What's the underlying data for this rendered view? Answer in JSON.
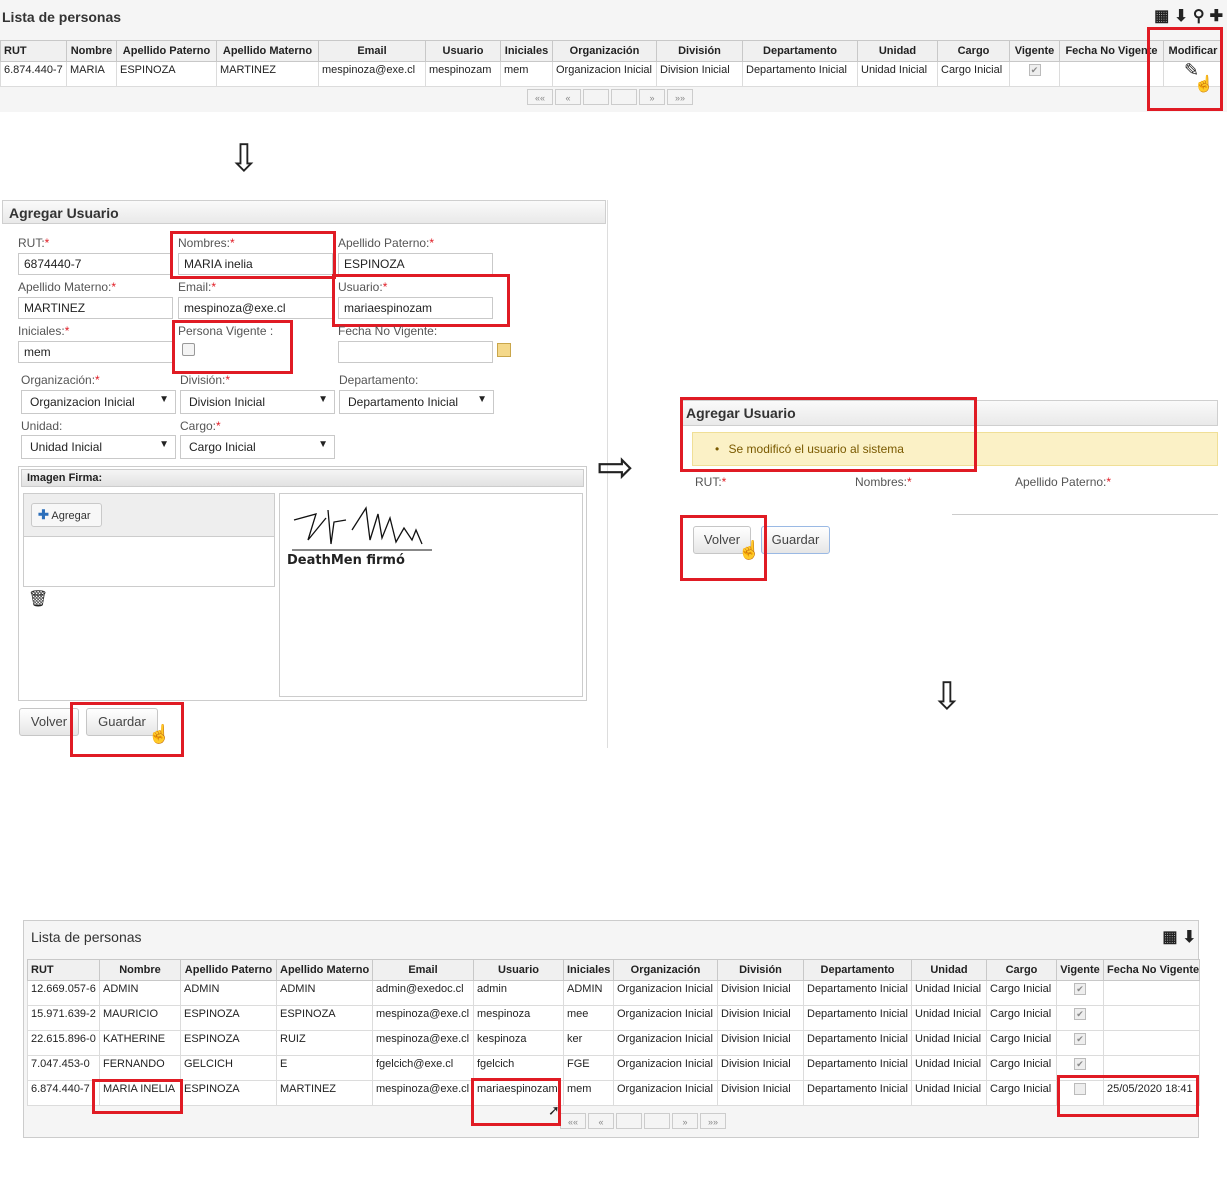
{
  "top_list": {
    "title": "Lista de personas",
    "columns": [
      "RUT",
      "Nombre",
      "Apellido Paterno",
      "Apellido Materno",
      "Email",
      "Usuario",
      "Iniciales",
      "Organización",
      "División",
      "Departamento",
      "Unidad",
      "Cargo",
      "Vigente",
      "Fecha No Vigente",
      "Modificar"
    ],
    "row": [
      "6.874.440-7",
      "MARIA",
      "ESPINOZA",
      "MARTINEZ",
      "mespinoza@exe.cl",
      "mespinozam",
      "mem",
      "Organizacion Inicial",
      "Division Inicial",
      "Departamento Inicial",
      "Unidad Inicial",
      "Cargo Inicial"
    ],
    "vigente_mark": "✔",
    "pager": [
      "««",
      "«",
      "",
      "",
      "»",
      "»»"
    ]
  },
  "form": {
    "title": "Agregar Usuario",
    "required_mark": "*",
    "rut_label": "RUT:",
    "rut_value": "6874440-7",
    "nombres_label": "Nombres:",
    "nombres_value": "MARIA inelia",
    "ap_pat_label": "Apellido Paterno:",
    "ap_pat_value": "ESPINOZA",
    "ap_mat_label": "Apellido Materno:",
    "ap_mat_value": "MARTINEZ",
    "email_label": "Email:",
    "email_value": "mespinoza@exe.cl",
    "usuario_label": "Usuario:",
    "usuario_value": "mariaespinozam",
    "iniciales_label": "Iniciales:",
    "iniciales_value": "mem",
    "vigente_label": "Persona Vigente :",
    "fecha_label": "Fecha No Vigente:",
    "org_label": "Organización:",
    "org_value": "Organizacion Inicial",
    "div_label": "División:",
    "div_value": "Division Inicial",
    "dep_label": "Departamento:",
    "dep_value": "Departamento Inicial",
    "uni_label": "Unidad:",
    "uni_value": "Unidad Inicial",
    "cargo_label": "Cargo:",
    "cargo_value": "Cargo Inicial",
    "firma_title": "Imagen Firma:",
    "agregar_label": "Agregar",
    "signature_caption": "DeathMen firmó",
    "volver_label": "Volver",
    "guardar_label": "Guardar"
  },
  "confirm": {
    "title": "Agregar Usuario",
    "message": "Se modificó el usuario al sistema",
    "rut_label": "RUT:",
    "nombres_label": "Nombres:",
    "ap_pat_label": "Apellido Paterno:",
    "volver_label": "Volver",
    "guardar_label": "Guardar"
  },
  "bottom_list": {
    "title": "Lista de personas",
    "columns": [
      "RUT",
      "Nombre",
      "Apellido Paterno",
      "Apellido Materno",
      "Email",
      "Usuario",
      "Iniciales",
      "Organización",
      "División",
      "Departamento",
      "Unidad",
      "Cargo",
      "Vigente",
      "Fecha No Vigente"
    ],
    "rows": [
      {
        "cells": [
          "12.669.057-6",
          "ADMIN",
          "ADMIN",
          "ADMIN",
          "admin@exedoc.cl",
          "admin",
          "ADMIN",
          "Organizacion Inicial",
          "Division Inicial",
          "Departamento Inicial",
          "Unidad Inicial",
          "Cargo Inicial"
        ],
        "vigente": "✔",
        "fecha": ""
      },
      {
        "cells": [
          "15.971.639-2",
          "MAURICIO",
          "ESPINOZA",
          "ESPINOZA",
          "mespinoza@exe.cl",
          "mespinoza",
          "mee",
          "Organizacion Inicial",
          "Division Inicial",
          "Departamento Inicial",
          "Unidad Inicial",
          "Cargo Inicial"
        ],
        "vigente": "✔",
        "fecha": ""
      },
      {
        "cells": [
          "22.615.896-0",
          "KATHERINE",
          "ESPINOZA",
          "RUIZ",
          "mespinoza@exe.cl",
          "kespinoza",
          "ker",
          "Organizacion Inicial",
          "Division Inicial",
          "Departamento Inicial",
          "Unidad Inicial",
          "Cargo Inicial"
        ],
        "vigente": "✔",
        "fecha": ""
      },
      {
        "cells": [
          "7.047.453-0",
          "FERNANDO",
          "GELCICH",
          "E",
          "fgelcich@exe.cl",
          "fgelcich",
          "FGE",
          "Organizacion Inicial",
          "Division Inicial",
          "Departamento Inicial",
          "Unidad Inicial",
          "Cargo Inicial"
        ],
        "vigente": "✔",
        "fecha": ""
      },
      {
        "cells": [
          "6.874.440-7",
          "MARIA INELIA",
          "ESPINOZA",
          "MARTINEZ",
          "mespinoza@exe.cl",
          "mariaespinozam",
          "mem",
          "Organizacion Inicial",
          "Division Inicial",
          "Departamento Inicial",
          "Unidad Inicial",
          "Cargo Inicial"
        ],
        "vigente": "",
        "fecha": "25/05/2020 18:41"
      }
    ],
    "pager": [
      "««",
      "«",
      "",
      "",
      "»",
      "»»"
    ]
  }
}
